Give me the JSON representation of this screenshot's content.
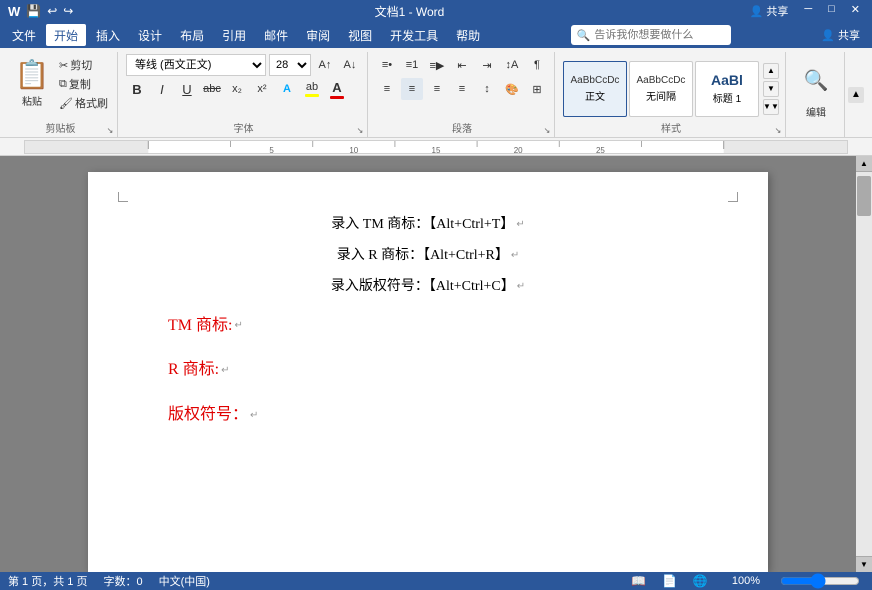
{
  "titlebar": {
    "doc_title": "文档1 - Word",
    "share_label": "共享",
    "close_label": "✕",
    "minimize_label": "─",
    "maximize_label": "□"
  },
  "menubar": {
    "items": [
      "文件",
      "开始",
      "插入",
      "设计",
      "布局",
      "引用",
      "邮件",
      "审阅",
      "视图",
      "开发工具",
      "帮助"
    ],
    "active_index": 1
  },
  "toolbar": {
    "search_placeholder": "告诉我你想要做什么",
    "clipboard": {
      "paste_label": "粘贴",
      "cut_label": "剪切",
      "copy_label": "复制",
      "format_label": "格式刷"
    },
    "font": {
      "name": "等线 (西文正文)",
      "size": "28",
      "bold": "B",
      "italic": "I",
      "underline": "U",
      "strikethrough": "abc",
      "subscript": "x₂",
      "superscript": "x²"
    },
    "paragraph": {
      "group_label": "段落"
    },
    "styles": {
      "group_label": "样式",
      "items": [
        {
          "label": "正文",
          "preview": "AaBbCcDc"
        },
        {
          "label": "无间隔",
          "preview": "AaBbCcDc"
        },
        {
          "label": "标题 1",
          "preview": "AaBl"
        }
      ]
    },
    "editing": {
      "label": "编辑"
    },
    "groups": {
      "clipboard_label": "剪贴板",
      "font_label": "字体",
      "paragraph_label": "段落",
      "styles_label": "样式"
    }
  },
  "document": {
    "lines": [
      {
        "type": "center",
        "text": "录入 TM 商标：【Alt+Ctrl+T】",
        "has_para": true
      },
      {
        "type": "center",
        "text": "录入 R 商标：【Alt+Ctrl+R】",
        "has_para": true
      },
      {
        "type": "center",
        "text": "录入版权符号：【Alt+Ctrl+C】",
        "has_para": true
      },
      {
        "type": "left",
        "text": "TM 商标:",
        "has_para": true,
        "red": true
      },
      {
        "type": "left",
        "text": "R 商标:",
        "has_para": true,
        "red": true
      },
      {
        "type": "left",
        "text": "版权符号：",
        "has_para": true,
        "red": true
      }
    ]
  },
  "statusbar": {
    "pages": "第 1 页，共 1 页",
    "words": "字数：0",
    "lang": "中文(中国)",
    "zoom": "100%"
  }
}
